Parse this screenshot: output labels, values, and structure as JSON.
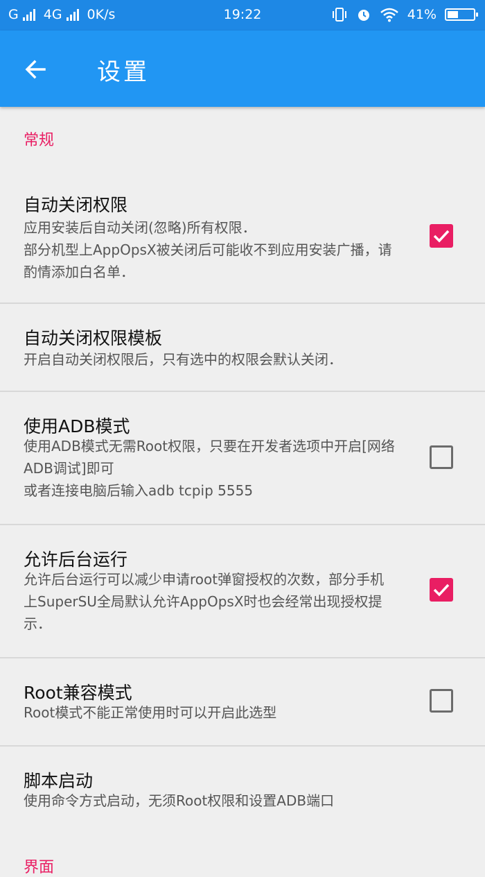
{
  "status_bar": {
    "carrier1": "G",
    "carrier2": "4G",
    "speed": "0K/s",
    "time": "19:22",
    "battery": "41%",
    "battery_level": 0.41
  },
  "toolbar": {
    "title": "设置"
  },
  "sections": {
    "general": "常规",
    "next": "界面"
  },
  "settings": [
    {
      "title": "自动关闭权限",
      "summary": "应用安装后自动关闭(忽略)所有权限．\n部分机型上AppOpsX被关闭后可能收不到应用安装广播，请酌情添加白名单．",
      "checked": true
    },
    {
      "title": "自动关闭权限模板",
      "summary": "开启自动关闭权限后，只有选中的权限会默认关闭．"
    },
    {
      "title": "使用ADB模式",
      "summary": "使用ADB模式无需Root权限，只要在开发者选项中开启[网络ADB调试]即可\n或者连接电脑后输入adb tcpip 5555",
      "checked": false
    },
    {
      "title": "允许后台运行",
      "summary": "允许后台运行可以减少申请root弹窗授权的次数，部分手机上SuperSU全局默认允许AppOpsX时也会经常出现授权提示．",
      "checked": true
    },
    {
      "title": "Root兼容模式",
      "summary": "Root模式不能正常使用时可以开启此选型",
      "checked": false
    },
    {
      "title": "脚本启动",
      "summary": "使用命令方式启动，无须Root权限和设置ADB端口"
    }
  ]
}
